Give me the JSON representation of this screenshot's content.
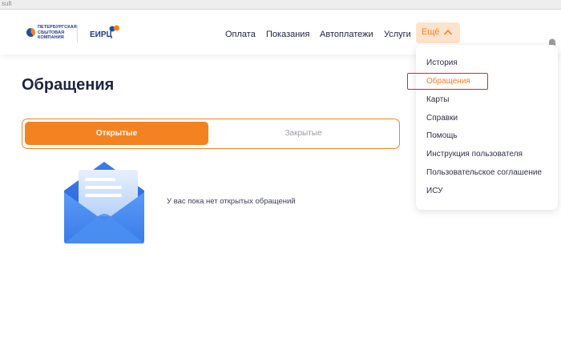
{
  "browser": {
    "tab_fragment": "sult"
  },
  "header": {
    "logo_psk_text": "ПЕТЕРБУРГСКАЯ\nСБЫТОВАЯ\nКОМПАНИЯ",
    "logo_eirc_text": "ЕИРЦ",
    "nav": [
      "Оплата",
      "Показания",
      "Автоплатежи",
      "Услуги"
    ],
    "more_label": "Ещё",
    "bell_icon": "bell-icon"
  },
  "main": {
    "title": "Обращения",
    "tabs": [
      {
        "label": "Открытые",
        "active": true
      },
      {
        "label": "Закрытые",
        "active": false
      }
    ],
    "empty_message": "У вас пока нет открытых обращений",
    "empty_icon": "envelope-icon"
  },
  "dropdown": {
    "items": [
      {
        "label": "История",
        "active": false
      },
      {
        "label": "Обращения",
        "active": true
      },
      {
        "label": "Карты",
        "active": false
      },
      {
        "label": "Справки",
        "active": false
      },
      {
        "label": "Помощь",
        "active": false
      },
      {
        "label": "Инструкция пользователя",
        "active": false
      },
      {
        "label": "Пользовательское соглашение",
        "active": false
      },
      {
        "label": "ИСУ",
        "active": false
      }
    ]
  },
  "colors": {
    "accent": "#f58220",
    "accent_light": "#fde3cc",
    "text_dark": "#1f2340",
    "brand_blue": "#1e3a8a",
    "highlight": "#e02424"
  }
}
